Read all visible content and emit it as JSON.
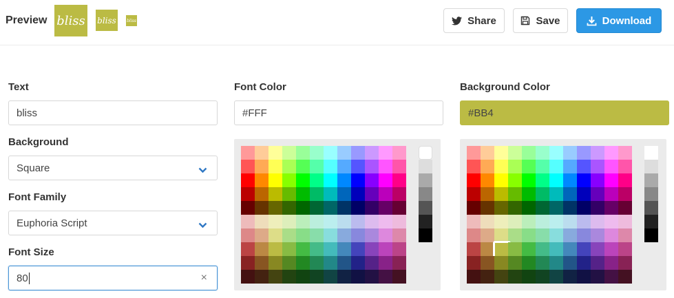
{
  "header": {
    "preview_label": "Preview",
    "preview_text": "bliss",
    "share_label": "Share",
    "save_label": "Save",
    "download_label": "Download",
    "icons": {
      "share": "twitter-bird-icon",
      "save": "floppy-disk-icon",
      "download": "download-arrow-icon"
    }
  },
  "form": {
    "text_label": "Text",
    "text_value": "bliss",
    "background_label": "Background",
    "background_value": "Square",
    "font_family_label": "Font Family",
    "font_family_value": "Euphoria Script",
    "font_size_label": "Font Size",
    "font_size_value": "80",
    "clear_symbol": "×"
  },
  "font_color": {
    "label": "Font Color",
    "value": "#FFF",
    "selected_gray_index": 0
  },
  "background_color": {
    "label": "Background Color",
    "value": "#BB4",
    "swatch_hex": "#BBBB44",
    "selected_swatch": [
      7,
      2
    ]
  },
  "palette": {
    "rows": [
      [
        "#FF9999",
        "#FFCC99",
        "#FFFF99",
        "#CCFF99",
        "#99FF99",
        "#99FFCC",
        "#99FFFF",
        "#99CCFF",
        "#9999FF",
        "#CC99FF",
        "#FF99FF",
        "#FF99CC"
      ],
      [
        "#FF5555",
        "#FFAA55",
        "#FFFF55",
        "#AAFF55",
        "#55FF55",
        "#55FFAA",
        "#55FFFF",
        "#55AAFF",
        "#5555FF",
        "#AA55FF",
        "#FF55FF",
        "#FF55AA"
      ],
      [
        "#FF0000",
        "#FF8800",
        "#FFFF00",
        "#88FF00",
        "#00FF00",
        "#00FF88",
        "#00FFFF",
        "#0088FF",
        "#0000FF",
        "#8800FF",
        "#FF00FF",
        "#FF0088"
      ],
      [
        "#BB0000",
        "#BB6600",
        "#BBBB00",
        "#66BB00",
        "#00BB00",
        "#00BB66",
        "#00BBBB",
        "#0066BB",
        "#0000BB",
        "#6600BB",
        "#BB00BB",
        "#BB0066"
      ],
      [
        "#660000",
        "#663300",
        "#666600",
        "#336600",
        "#006600",
        "#006633",
        "#006666",
        "#003366",
        "#000066",
        "#330066",
        "#660066",
        "#660033"
      ],
      [
        "#EEBBBB",
        "#EEDDBB",
        "#EEEEBB",
        "#DDEEBB",
        "#BBEEBB",
        "#BBEEDD",
        "#BBEEEE",
        "#BBDDEE",
        "#BBBBEE",
        "#DDBBEE",
        "#EEBBEE",
        "#EEBBDD"
      ],
      [
        "#DD8888",
        "#DDAA88",
        "#DDDD88",
        "#AADD88",
        "#88DD88",
        "#88DDAA",
        "#88DDDD",
        "#88AADD",
        "#8888DD",
        "#AA88DD",
        "#DD88DD",
        "#DD88AA"
      ],
      [
        "#BB4444",
        "#BB8844",
        "#BBBB44",
        "#88BB44",
        "#44BB44",
        "#44BB88",
        "#44BBBB",
        "#4488BB",
        "#4444BB",
        "#8844BB",
        "#BB44BB",
        "#BB4488"
      ],
      [
        "#882222",
        "#885522",
        "#888822",
        "#558822",
        "#228822",
        "#228855",
        "#228888",
        "#225588",
        "#222288",
        "#552288",
        "#882288",
        "#882255"
      ],
      [
        "#441111",
        "#442211",
        "#444411",
        "#224411",
        "#114411",
        "#114422",
        "#114444",
        "#112244",
        "#111144",
        "#221144",
        "#441144",
        "#441122"
      ]
    ],
    "grays": [
      "#FFFFFF",
      "#DDDDDD",
      "#AAAAAA",
      "#888888",
      "#555555",
      "#222222",
      "#000000"
    ]
  }
}
